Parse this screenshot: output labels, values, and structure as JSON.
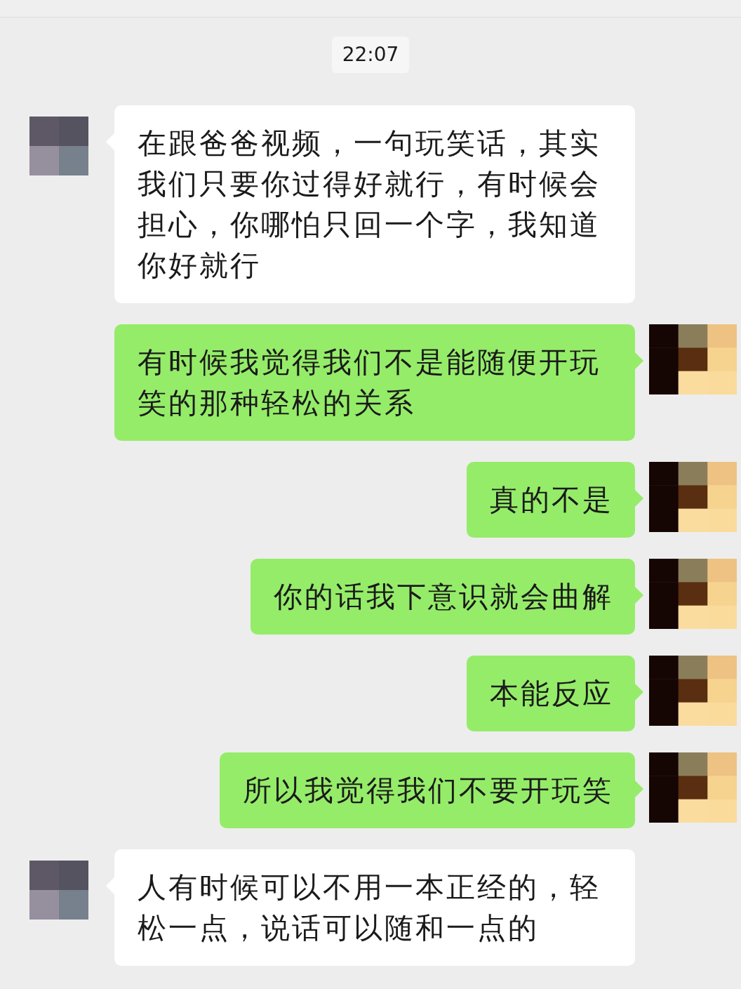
{
  "timestamp": "22:07",
  "messages": [
    {
      "kind": "left",
      "text": "在跟爸爸视频，一句玩笑话，其实我们只要你过得好就行，有时候会担心，你哪怕只回一个字，我知道你好就行"
    },
    {
      "kind": "right",
      "text": "有时候我觉得我们不是能随便开玩笑的那种轻松的关系"
    },
    {
      "kind": "right",
      "text": "真的不是"
    },
    {
      "kind": "right",
      "text": "你的话我下意识就会曲解"
    },
    {
      "kind": "right",
      "text": "本能反应"
    },
    {
      "kind": "right",
      "text": "所以我觉得我们不要开玩笑"
    },
    {
      "kind": "left",
      "text": "人有时候可以不用一本正经的，轻松一点，说话可以随和一点的"
    }
  ]
}
